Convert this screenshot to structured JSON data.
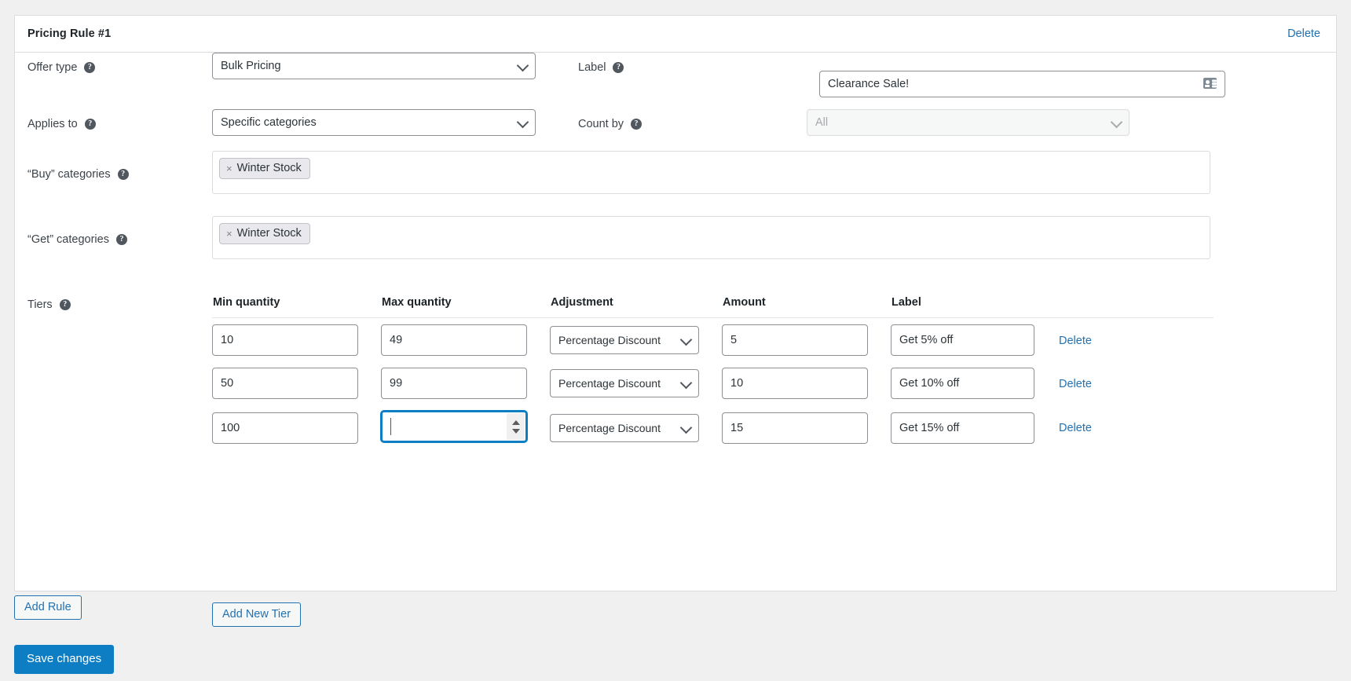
{
  "rule": {
    "title": "Pricing Rule #1",
    "delete_label": "Delete"
  },
  "fields": {
    "offer_type": {
      "label": "Offer type",
      "help": "?",
      "value": "Bulk Pricing",
      "options": [
        "Bulk Pricing"
      ]
    },
    "label": {
      "label": "Label",
      "help": "?",
      "value": "Clearance Sale!",
      "icon": "id-card-icon"
    },
    "applies_to": {
      "label": "Applies to",
      "help": "?",
      "value": "Specific categories",
      "options": [
        "Specific categories"
      ]
    },
    "count_by": {
      "label": "Count by",
      "help": "?",
      "value": "All",
      "options": [
        "All"
      ],
      "disabled": true
    },
    "buy_categories": {
      "label": "“Buy” categories",
      "help": "?",
      "tokens": [
        {
          "remove": "×",
          "text": "Winter Stock"
        }
      ]
    },
    "get_categories": {
      "label": "“Get” categories",
      "help": "?",
      "tokens": [
        {
          "remove": "×",
          "text": "Winter Stock"
        }
      ]
    },
    "tiers": {
      "label": "Tiers",
      "help": "?"
    }
  },
  "tiers_table": {
    "headers": {
      "min": "Min quantity",
      "max": "Max quantity",
      "adjustment": "Adjustment",
      "amount": "Amount",
      "label": "Label",
      "actions": ""
    },
    "rows": [
      {
        "min": "10",
        "max": "49",
        "adjustment": "Percentage Discount",
        "amount": "5",
        "label": "Get 5% off",
        "delete": "Delete",
        "max_focused": false
      },
      {
        "min": "50",
        "max": "99",
        "adjustment": "Percentage Discount",
        "amount": "10",
        "label": "Get 10% off",
        "delete": "Delete",
        "max_focused": false
      },
      {
        "min": "100",
        "max": "",
        "adjustment": "Percentage Discount",
        "amount": "15",
        "label": "Get 15% off",
        "delete": "Delete",
        "max_focused": true
      }
    ],
    "adjustment_options": [
      "Percentage Discount"
    ]
  },
  "buttons": {
    "add_new_tier": "Add New Tier",
    "add_rule": "Add Rule",
    "save_changes": "Save changes"
  },
  "colors": {
    "accent": "#2271b1",
    "primary_button": "#0d7ec4",
    "focus_border": "#0d7ec4",
    "page_background": "#f0f0f1",
    "card_background": "#ffffff",
    "border": "#dcdcde"
  }
}
